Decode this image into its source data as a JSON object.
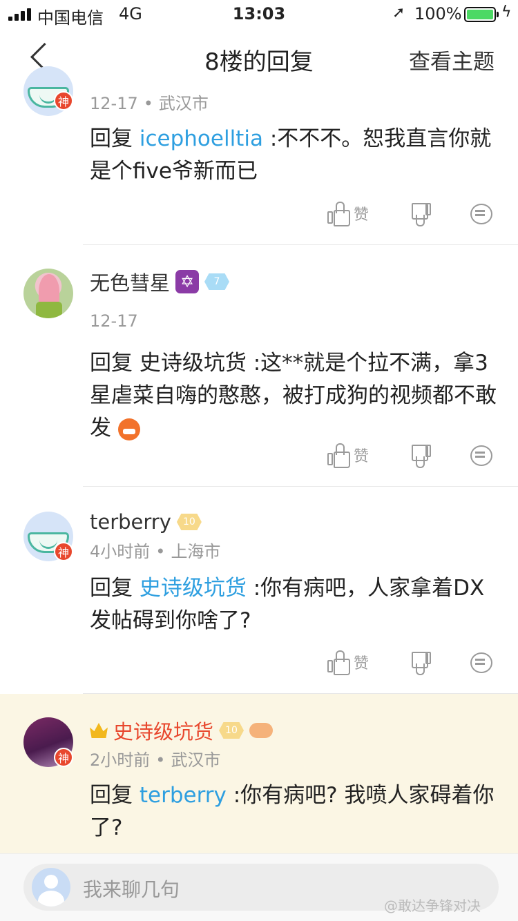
{
  "status_bar": {
    "carrier": "中国电信",
    "network": "4G",
    "time": "13:03",
    "battery_percent": "100%",
    "battery_level": 1.0,
    "battery_color": "#4cd964"
  },
  "nav": {
    "back_icon": "chevron-left-icon",
    "title": "8楼的回复",
    "view_topic": "查看主题"
  },
  "comments": [
    {
      "name": "",
      "meta_time": "12-17",
      "meta_location": "武汉市",
      "reply_prefix": "回复",
      "reply_to": "icephoelltia",
      "body": ":不不不。恕我直言你就是个five爷新而已",
      "avatar_badge": "神",
      "like_label": "赞"
    },
    {
      "name": "无色彗星",
      "level": "7",
      "meta_time": "12-17",
      "reply_prefix": "回复",
      "reply_to": "史诗级坑货",
      "body": ":这**就是个拉不满，拿3星虐菜自嗨的憨憨，被打成狗的视频都不敢发",
      "like_label": "赞"
    },
    {
      "name": "terberry",
      "level": "10",
      "meta_time": "4小时前",
      "meta_location": "上海市",
      "reply_prefix": "回复",
      "reply_to": "史诗级坑货",
      "body": ":你有病吧，人家拿着DX发帖碍到你啥了?",
      "avatar_badge": "神",
      "like_label": "赞"
    },
    {
      "name": "史诗级坑货",
      "level": "10",
      "meta_time": "2小时前",
      "meta_location": "武汉市",
      "reply_prefix": "回复",
      "reply_to": "terberry",
      "body": ":你有病吧? 我喷人家碍着你了?",
      "avatar_badge": "神"
    }
  ],
  "colors": {
    "link": "#2e9fe0",
    "highlight_bg": "#fbf6e4",
    "author_red": "#e8472d"
  },
  "input": {
    "placeholder": "我来聊几句"
  },
  "watermark": "@敢达争锋对决"
}
